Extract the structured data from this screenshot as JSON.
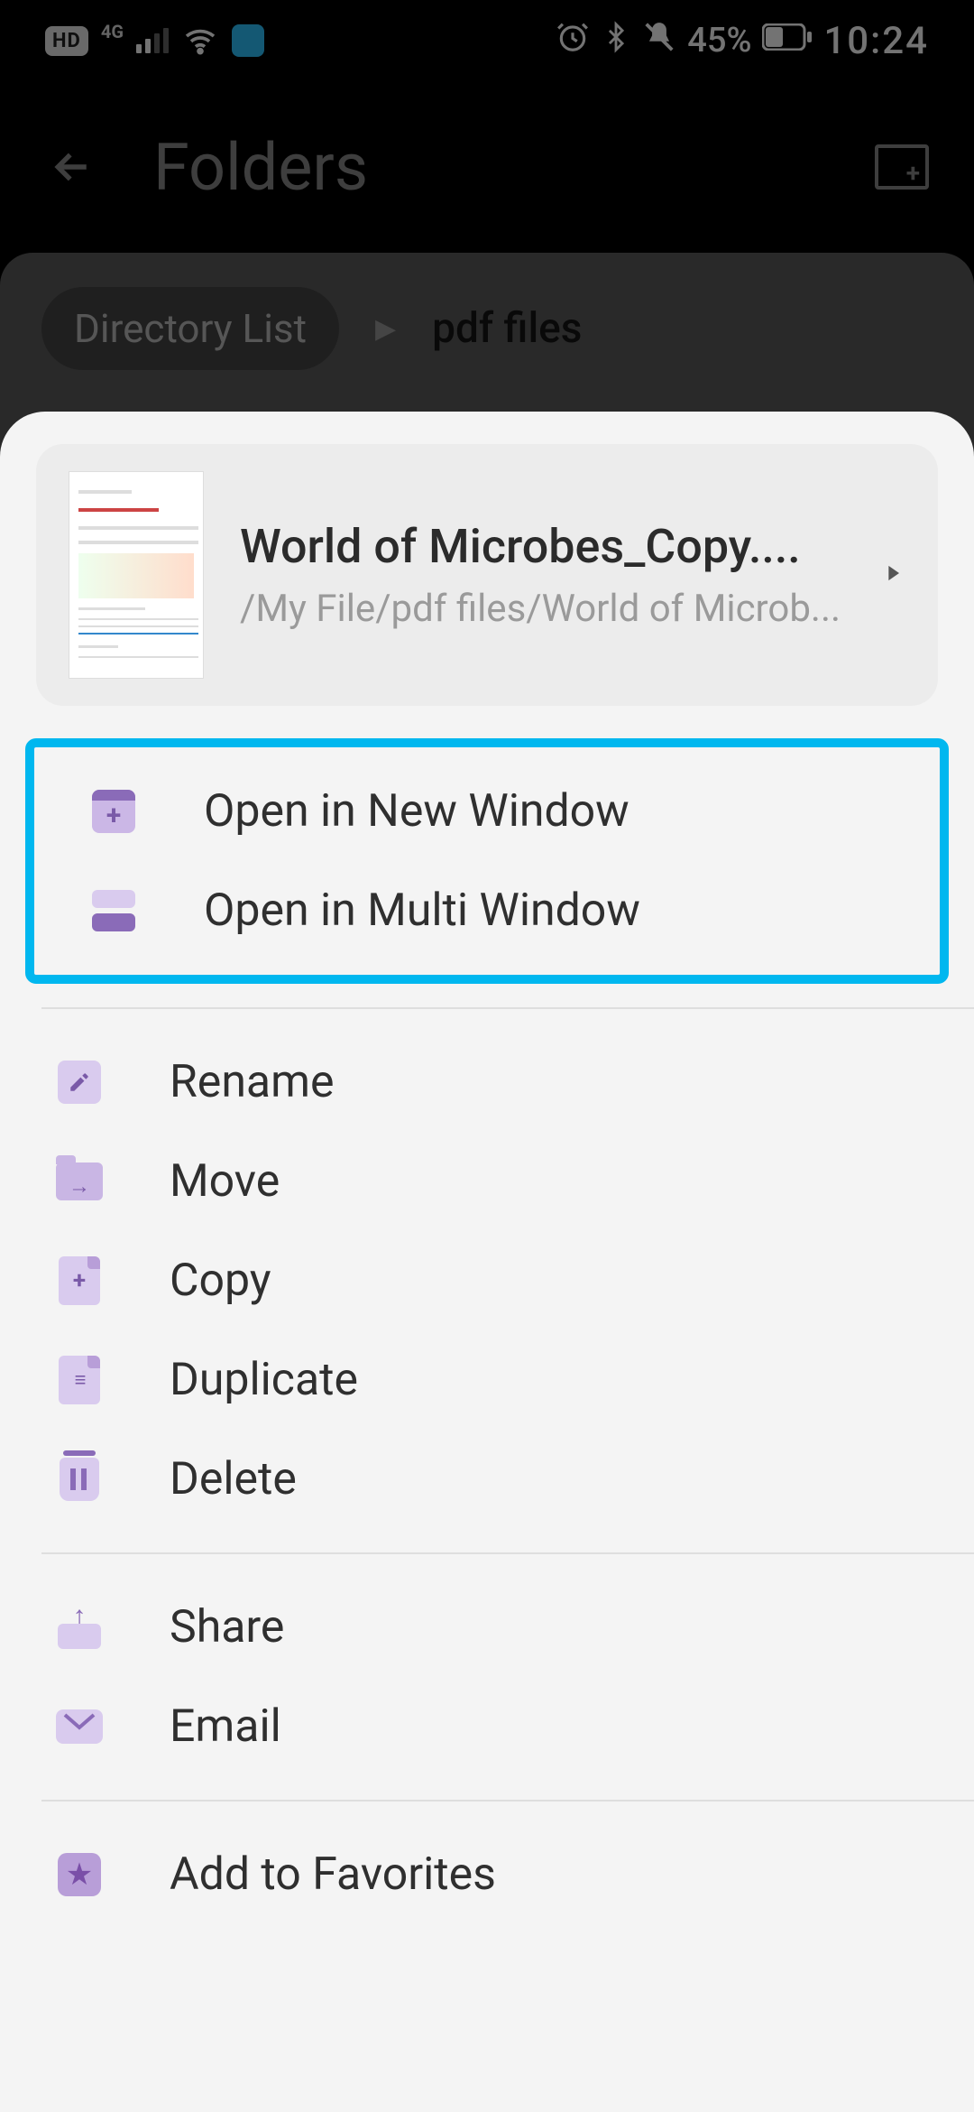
{
  "status": {
    "hd": "HD",
    "net": "4G",
    "battery": "45%",
    "time": "10:24"
  },
  "appbar": {
    "title": "Folders"
  },
  "breadcrumb": {
    "root": "Directory List",
    "current": "pdf files"
  },
  "file": {
    "title": "World of Microbes_Copy....",
    "path": "/My File/pdf files/World of Microb..."
  },
  "menu": {
    "open_new_window": "Open in New Window",
    "open_multi_window": "Open in Multi Window",
    "rename": "Rename",
    "move": "Move",
    "copy": "Copy",
    "duplicate": "Duplicate",
    "delete": "Delete",
    "share": "Share",
    "email": "Email",
    "add_favorites": "Add to Favorites"
  }
}
